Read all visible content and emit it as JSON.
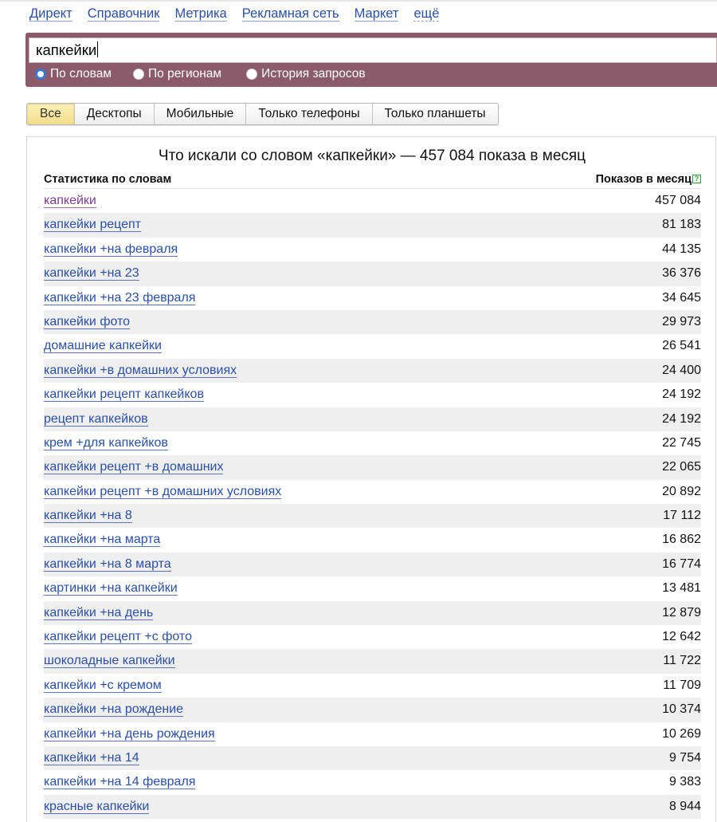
{
  "nav": {
    "items": [
      "Директ",
      "Справочник",
      "Метрика",
      "Рекламная сеть",
      "Маркет"
    ],
    "more": "ещё"
  },
  "search": {
    "value": "капкейки",
    "modes": [
      "По словам",
      "По регионам",
      "История запросов"
    ],
    "selected_mode": "По словам"
  },
  "device_tabs": {
    "items": [
      "Все",
      "Десктопы",
      "Мобильные",
      "Только телефоны",
      "Только планшеты"
    ],
    "active": "Все"
  },
  "results": {
    "title": "Что искали со словом «капкейки» — 457 084 показа в месяц",
    "col_phrase": "Статистика по словам",
    "col_count": "Показов в месяц",
    "help_icon": "?",
    "rows": [
      {
        "phrase": "капкейки",
        "count": "457 084"
      },
      {
        "phrase": "капкейки рецепт",
        "count": "81 183"
      },
      {
        "phrase": "капкейки +на февраля",
        "count": "44 135"
      },
      {
        "phrase": "капкейки +на 23",
        "count": "36 376"
      },
      {
        "phrase": "капкейки +на 23 февраля",
        "count": "34 645"
      },
      {
        "phrase": "капкейки фото",
        "count": "29 973"
      },
      {
        "phrase": "домашние капкейки",
        "count": "26 541"
      },
      {
        "phrase": "капкейки +в домашних условиях",
        "count": "24 400"
      },
      {
        "phrase": "капкейки рецепт капкейков",
        "count": "24 192"
      },
      {
        "phrase": "рецепт капкейков",
        "count": "24 192"
      },
      {
        "phrase": "крем +для капкейков",
        "count": "22 745"
      },
      {
        "phrase": "капкейки рецепт +в домашних",
        "count": "22 065"
      },
      {
        "phrase": "капкейки рецепт +в домашних условиях",
        "count": "20 892"
      },
      {
        "phrase": "капкейки +на 8",
        "count": "17 112"
      },
      {
        "phrase": "капкейки +на марта",
        "count": "16 862"
      },
      {
        "phrase": "капкейки +на 8 марта",
        "count": "16 774"
      },
      {
        "phrase": "картинки +на капкейки",
        "count": "13 481"
      },
      {
        "phrase": "капкейки +на день",
        "count": "12 879"
      },
      {
        "phrase": "капкейки рецепт +с фото",
        "count": "12 642"
      },
      {
        "phrase": "шоколадные капкейки",
        "count": "11 722"
      },
      {
        "phrase": "капкейки +с кремом",
        "count": "11 709"
      },
      {
        "phrase": "капкейки +на рождение",
        "count": "10 374"
      },
      {
        "phrase": "капкейки +на день рождения",
        "count": "10 269"
      },
      {
        "phrase": "капкейки +на 14",
        "count": "9 754"
      },
      {
        "phrase": "капкейки +на 14 февраля",
        "count": "9 383"
      },
      {
        "phrase": "красные капкейки",
        "count": "8 944"
      }
    ]
  },
  "colors": {
    "link": "#2a4fa5",
    "visited_link": "#7a3d8c",
    "search_panel": "#8b5b6b",
    "active_tab": "#f3dd8c",
    "row_stripe": "#efefef"
  }
}
